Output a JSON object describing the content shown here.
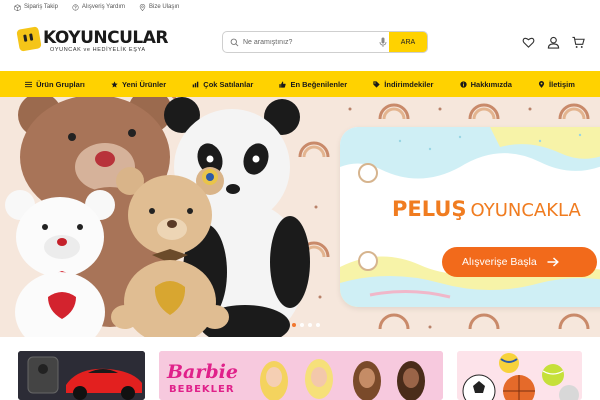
{
  "utility": {
    "order_tracking": "Sipariş Takip",
    "shopping_help": "Alışveriş Yardım",
    "contact": "Bize Ulaşın"
  },
  "brand": {
    "name": "KOYUNCULAR",
    "tagline": "OYUNCAK ve HEDİYELİK EŞYA",
    "accent": "#ffd200",
    "cta_color": "#f26a1b"
  },
  "search": {
    "placeholder": "Ne aramıştınız?",
    "value": "",
    "button_label": "ARA"
  },
  "header_icons": [
    "heart-icon",
    "user-icon",
    "cart-icon"
  ],
  "nav": {
    "items": [
      {
        "label": "Ürün Grupları",
        "icon": "menu-icon"
      },
      {
        "label": "Yeni Ürünler",
        "icon": "star-icon"
      },
      {
        "label": "Çok Satılanlar",
        "icon": "chart-icon"
      },
      {
        "label": "En Beğenilenler",
        "icon": "thumbs-up-icon"
      },
      {
        "label": "İndirimdekiler",
        "icon": "tag-icon"
      },
      {
        "label": "Hakkımızda",
        "icon": "info-icon"
      },
      {
        "label": "İletişim",
        "icon": "location-icon"
      }
    ]
  },
  "hero": {
    "title_bold": "PELUŞ",
    "title_rest": "OYUNCAKLA",
    "cta_label": "Alışverişe Başla",
    "slide_count": 4,
    "active_slide": 1
  },
  "tiles": {
    "barbie_title": "Barbie",
    "barbie_subtitle": "BEBEKLER"
  }
}
